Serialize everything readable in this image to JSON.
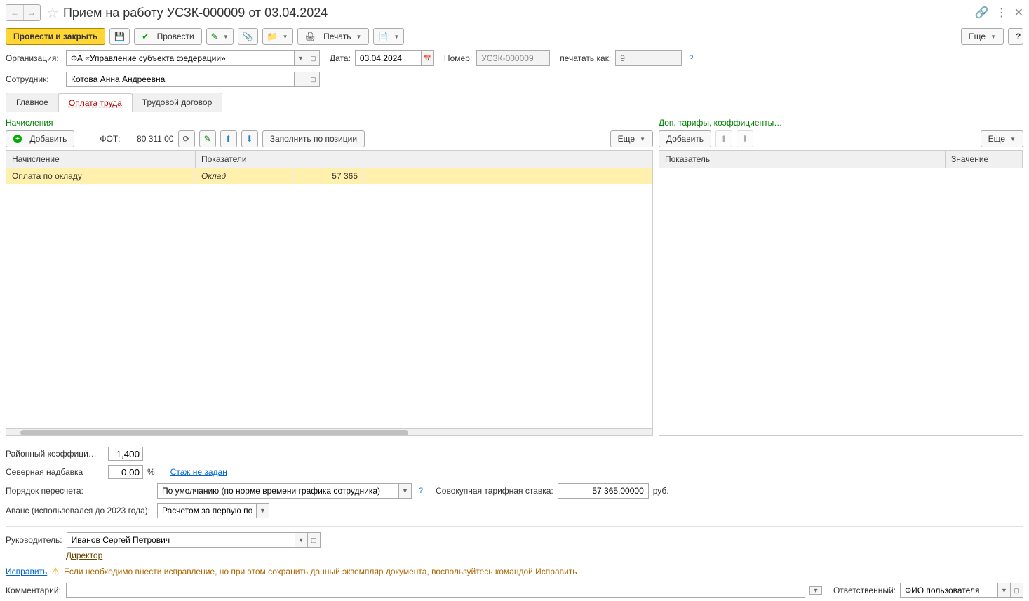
{
  "title": "Прием на работу УСЗК-000009 от 03.04.2024",
  "toolbar": {
    "postAndClose": "Провести и закрыть",
    "post": "Провести",
    "print": "Печать",
    "more": "Еще"
  },
  "help": "?",
  "fields": {
    "orgLabel": "Организация:",
    "orgValue": "ФА «Управление субъекта федерации»",
    "dateLabel": "Дата:",
    "dateValue": "03.04.2024",
    "numLabel": "Номер:",
    "numValue": "УСЗК-000009",
    "printAsLabel": "печатать как:",
    "printAsValue": "9",
    "empLabel": "Сотрудник:",
    "empValue": "Котова Анна Андреевна"
  },
  "tabs": {
    "main": "Главное",
    "pay": "Оплата труда",
    "contract": "Трудовой договор"
  },
  "accruals": {
    "title": "Начисления",
    "add": "Добавить",
    "fotLabel": "ФОТ:",
    "fotValue": "80 311,00",
    "fillByPos": "Заполнить по позиции",
    "more": "Еще",
    "colAccrual": "Начисление",
    "colIndicators": "Показатели",
    "rowAccrual": "Оплата по окладу",
    "rowIndicator": "Оклад",
    "rowValue": "57 365"
  },
  "coeffs": {
    "title": "Доп. тарифы, коэффициенты…",
    "add": "Добавить",
    "more": "Еще",
    "colIndicator": "Показатель",
    "colValue": "Значение"
  },
  "bottom": {
    "regCoeffLabel": "Районный коэффици…",
    "regCoeffVal": "1,400",
    "northLabel": "Северная надбавка",
    "northVal": "0,00",
    "northPct": "%",
    "stazhLink": "Стаж не задан",
    "recalcLabel": "Порядок пересчета:",
    "recalcVal": "По умолчанию (по норме времени графика сотрудника)",
    "tariffLabel": "Совокупная тарифная ставка:",
    "tariffVal": "57 365,00000",
    "tariffUnit": "руб.",
    "advanceLabel": "Аванс (использовался до 2023 года):",
    "advanceVal": "Расчетом за первую пол"
  },
  "manager": {
    "label": "Руководитель:",
    "value": "Иванов Сергей Петрович",
    "position": "Директор"
  },
  "fix": {
    "link": "Исправить",
    "text": "Если необходимо внести исправление, но при этом сохранить данный экземпляр документа, воспользуйтесь командой Исправить"
  },
  "comment": {
    "label": "Комментарий:",
    "respLabel": "Ответственный:",
    "respVal": "ФИО пользователя"
  }
}
